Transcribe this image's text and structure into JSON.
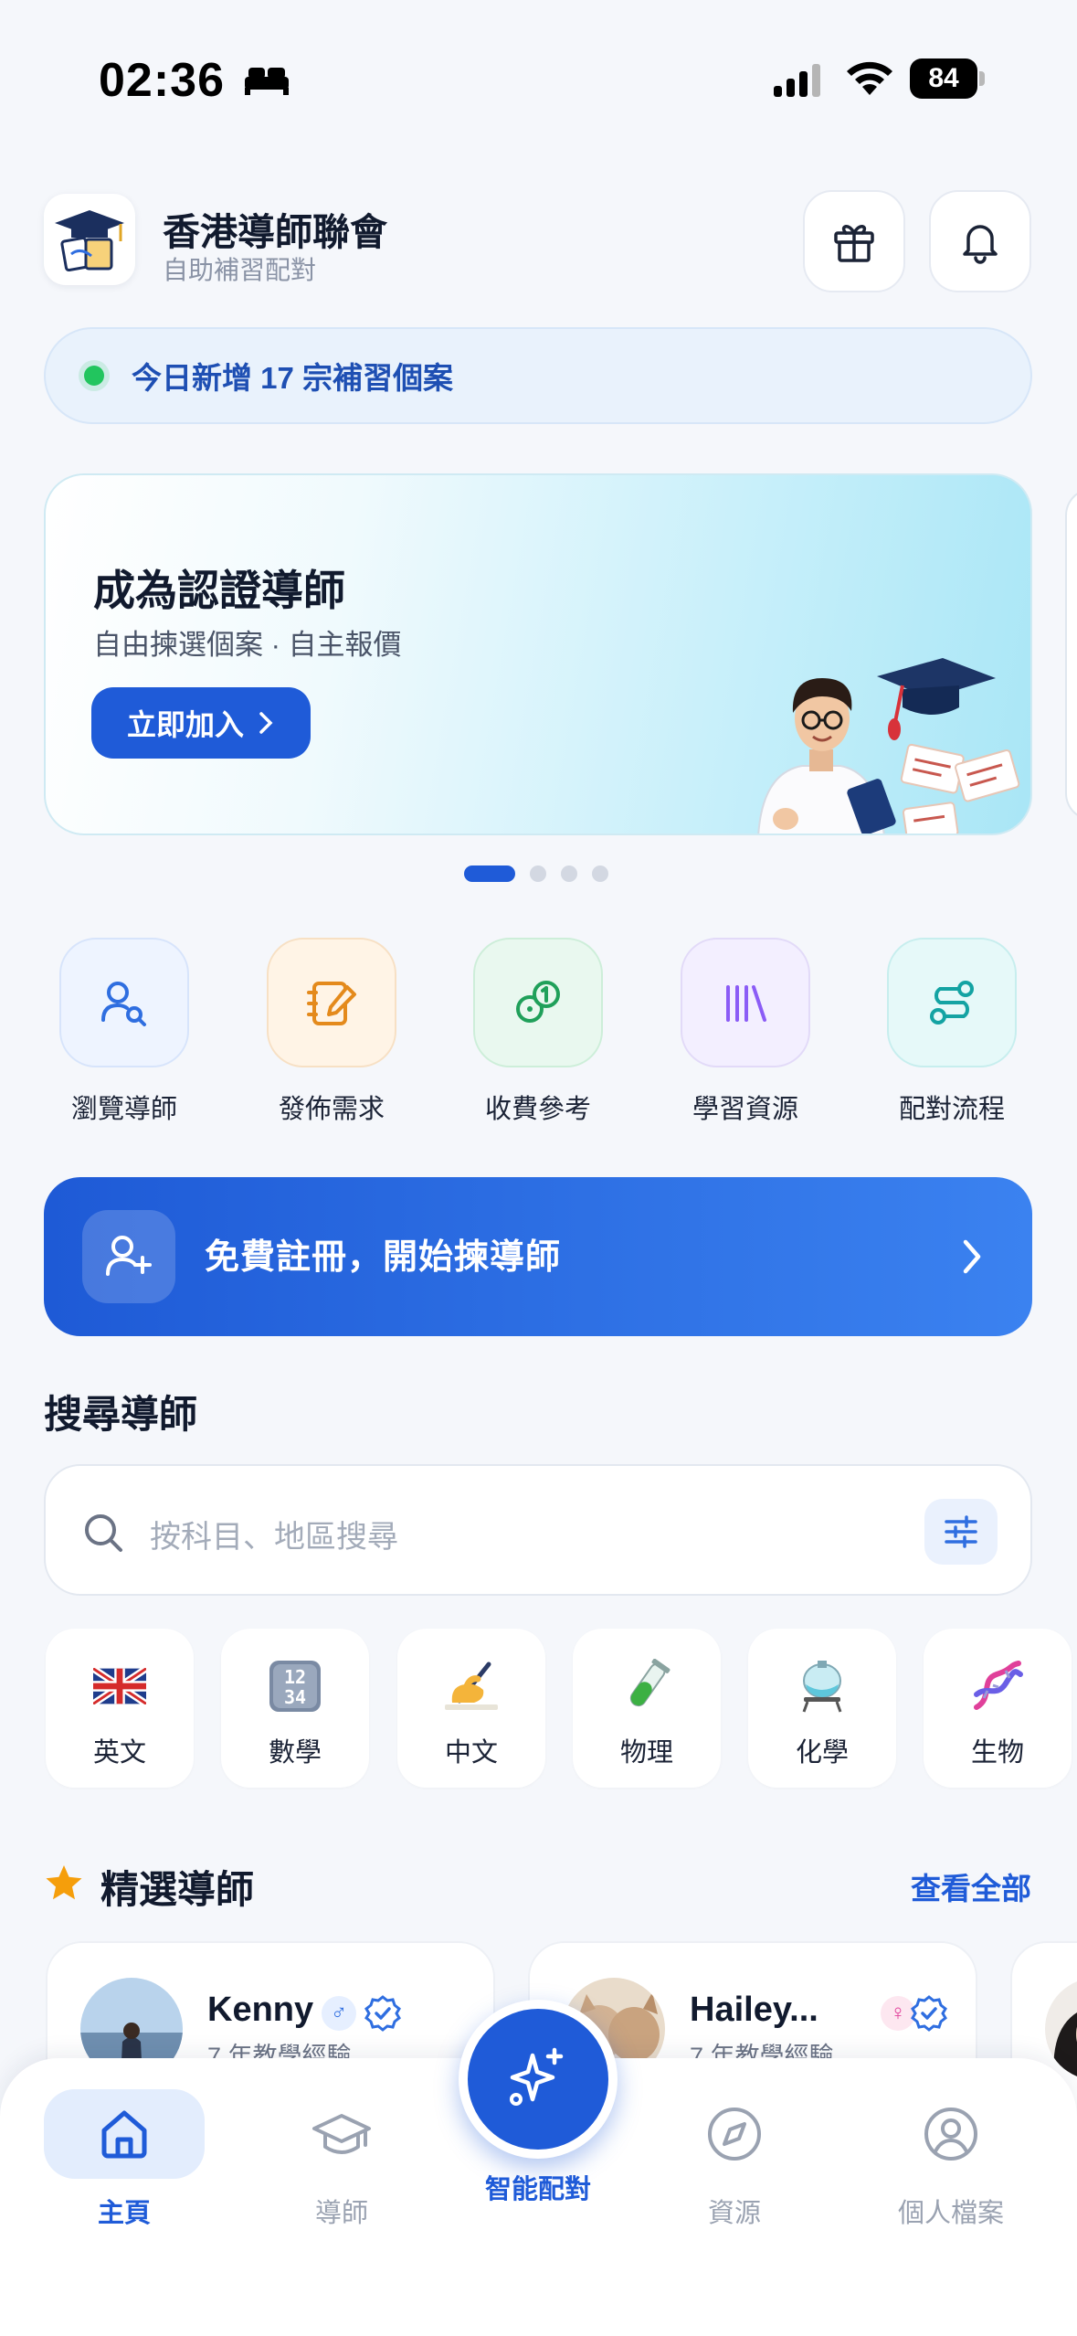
{
  "status_bar": {
    "time": "02:36",
    "battery": "84"
  },
  "header": {
    "title": "香港導師聯會",
    "subtitle": "自助補習配對"
  },
  "ticker": {
    "text": "今日新增 17 宗補習個案"
  },
  "banner": {
    "title": "成為認證導師",
    "subtitle": "自由揀選個案 · 自主報價",
    "cta": "立即加入",
    "page_count": 4,
    "active_page": 1
  },
  "quick_actions": [
    {
      "label": "瀏覽導師",
      "icon": "user-search-icon",
      "color": "#2f6ee0"
    },
    {
      "label": "發佈需求",
      "icon": "notebook-edit-icon",
      "color": "#e48a1c"
    },
    {
      "label": "收費參考",
      "icon": "coins-icon",
      "color": "#20a05a"
    },
    {
      "label": "學習資源",
      "icon": "library-icon",
      "color": "#8b5cf6"
    },
    {
      "label": "配對流程",
      "icon": "route-icon",
      "color": "#14a3a3"
    }
  ],
  "register_cta": {
    "label": "免費註冊，開始揀導師"
  },
  "search": {
    "section_title": "搜尋導師",
    "placeholder": "按科目、地區搜尋"
  },
  "subjects": [
    {
      "label": "英文",
      "icon": "uk-flag-icon"
    },
    {
      "label": "數學",
      "icon": "numbers-icon"
    },
    {
      "label": "中文",
      "icon": "writing-hand-icon"
    },
    {
      "label": "物理",
      "icon": "test-tube-icon"
    },
    {
      "label": "化學",
      "icon": "flask-icon"
    },
    {
      "label": "生物",
      "icon": "dna-icon"
    }
  ],
  "featured": {
    "title": "精選導師",
    "view_all": "查看全部",
    "tutors": [
      {
        "name": "Kenny",
        "gender": "♂",
        "experience": "7 年教學經驗"
      },
      {
        "name": "Hailey...",
        "gender": "♀",
        "experience": "7 年教學經驗"
      }
    ]
  },
  "bottom_nav": {
    "items": [
      {
        "label": "主頁",
        "icon": "home-icon",
        "active": true
      },
      {
        "label": "導師",
        "icon": "graduation-cap-icon",
        "active": false
      },
      {
        "label": "智能配對",
        "icon": "sparkles-icon",
        "active": false
      },
      {
        "label": "資源",
        "icon": "compass-icon",
        "active": false
      },
      {
        "label": "個人檔案",
        "icon": "user-circle-icon",
        "active": false
      }
    ]
  },
  "colors": {
    "primary": "#1f5bd8",
    "accent_green": "#22c55e",
    "background": "#f5f7fb"
  }
}
